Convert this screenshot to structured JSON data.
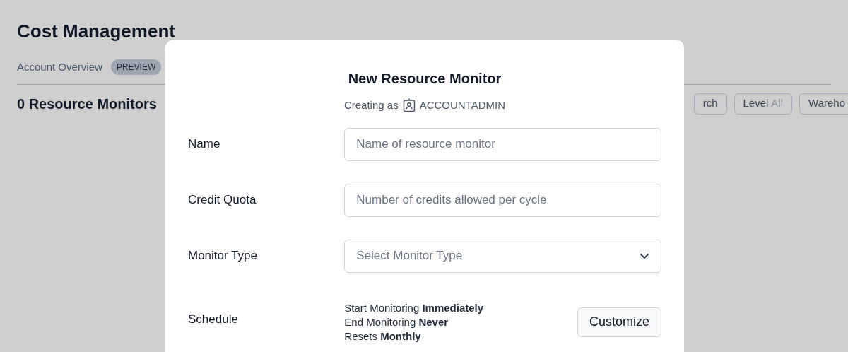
{
  "page": {
    "title": "Cost Management",
    "tabs": [
      {
        "label": "Account Overview",
        "badge": "PREVIEW",
        "selected": false
      }
    ],
    "heading": "0 Resource Monitors",
    "filters": [
      {
        "kind": "plain",
        "label": "rch"
      },
      {
        "kind": "labeled",
        "label": "Level",
        "value": "All"
      },
      {
        "kind": "plain",
        "label": "Wareho"
      }
    ]
  },
  "dialog": {
    "title": "New Resource Monitor",
    "subtitle": "Creating as",
    "role": "ACCOUNTADMIN",
    "fields": [
      {
        "kind": "text",
        "label": "Name",
        "placeholder": "Name of resource monitor"
      },
      {
        "kind": "text",
        "label": "Credit Quota",
        "placeholder": "Number of credits allowed per cycle"
      },
      {
        "kind": "select",
        "label": "Monitor Type",
        "placeholder": "Select Monitor Type"
      },
      {
        "kind": "schedule",
        "label": "Schedule",
        "lines": [
          "Start Monitoring **Immediately**",
          "End Monitoring **Never**",
          "Resets **Monthly**"
        ],
        "button": "Customize"
      }
    ]
  }
}
